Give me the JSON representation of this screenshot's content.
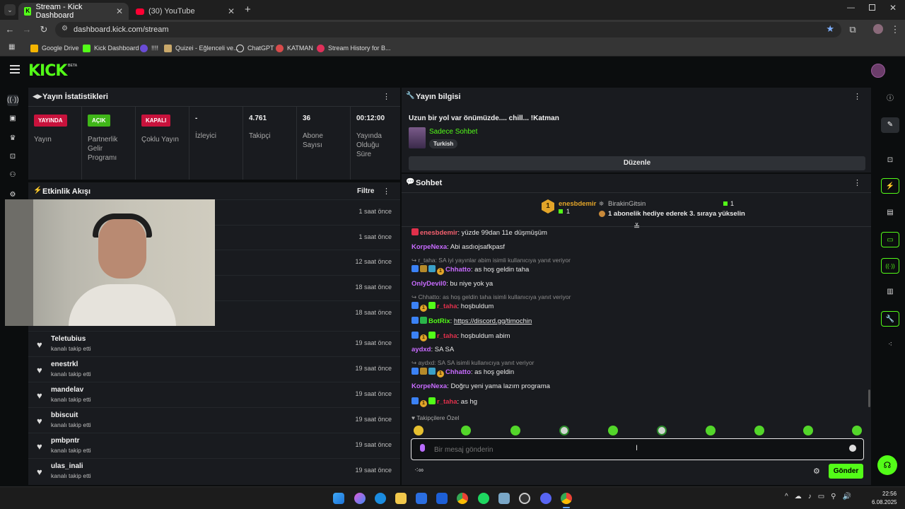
{
  "browser": {
    "tabs": [
      {
        "label": "Stream - Kick Dashboard"
      },
      {
        "label": "(30) YouTube"
      }
    ],
    "url": "dashboard.kick.com/stream",
    "bookmarks": [
      "Google Drive",
      "Kick Dashboard",
      "!!!!",
      "Quizei - Eğlenceli ve...",
      "ChatGPT",
      "KATMAN",
      "Stream History for B..."
    ]
  },
  "app": {
    "logo": "KICK",
    "beta": "BETA"
  },
  "stats": {
    "title": "Yayın İstatistikleri",
    "cells": [
      {
        "badge": "YAYINDA",
        "badge_color": "#c8123c",
        "label": "Yayın"
      },
      {
        "badge": "AÇIK",
        "badge_color": "#3fb618",
        "label": "Partnerlik Gelir Programı"
      },
      {
        "badge": "KAPALI",
        "badge_color": "#c8123c",
        "label": "Çoklu Yayın"
      },
      {
        "value": "-",
        "label": "İzleyici"
      },
      {
        "value": "4.761",
        "label": "Takipçi"
      },
      {
        "value": "36",
        "label": "Abone Sayısı"
      },
      {
        "value": "00:12:00",
        "label": "Yayında Olduğu Süre"
      }
    ]
  },
  "events": {
    "title": "Etkinlik Akışı",
    "filter": "Filtre",
    "hidden_rows": [
      {
        "time": "1 saat önce"
      },
      {
        "time": "1 saat önce"
      },
      {
        "time": "12 saat önce"
      },
      {
        "time": "18 saat önce"
      },
      {
        "time": "18 saat önce"
      }
    ],
    "rows": [
      {
        "name": "Teletubius",
        "sub": "kanalı takip etti",
        "time": "19 saat önce"
      },
      {
        "name": "enestrkl",
        "sub": "kanalı takip etti",
        "time": "19 saat önce"
      },
      {
        "name": "mandelav",
        "sub": "kanalı takip etti",
        "time": "19 saat önce"
      },
      {
        "name": "bbiscuit",
        "sub": "kanalı takip etti",
        "time": "19 saat önce"
      },
      {
        "name": "pmbpntr",
        "sub": "kanalı takip etti",
        "time": "19 saat önce"
      },
      {
        "name": "ulas_inali",
        "sub": "kanalı takip etti",
        "time": "19 saat önce"
      }
    ]
  },
  "stream_info": {
    "title": "Yayın bilgisi",
    "stream_title": "Uzun bir yol var önümüzde.... chill... !Katman",
    "category": "Sadece Sohbet",
    "language": "Turkish",
    "edit_button": "Düzenle"
  },
  "chat": {
    "title": "Sohbet",
    "pinned": {
      "user": "enesbdemir",
      "user_count": "1",
      "gifter": "BirakinGitsin",
      "gifter_count": "1",
      "message": "1 abonelik hediye ederek 3. sıraya yükselin"
    },
    "messages": [
      {
        "user": "enesbdemir",
        "color": "#f5606e",
        "text": ": yüzde 99dan 11e düşmüşüm"
      },
      {
        "user": "KorpeNexa",
        "color": "#c86bff",
        "text": ": Abi asdıojsafkpasf"
      },
      {
        "reply": "↪ r_taha: SA iyi yayınlar abim isimli kullanıcıya yanıt veriyor"
      },
      {
        "user": "Chhatto",
        "color": "#c86bff",
        "text": ": as hoş geldin taha"
      },
      {
        "user": "OnlyDevil0",
        "color": "#c86bff",
        "text": ": bu niye yok ya"
      },
      {
        "reply": "↪ Chhatto: as hoş geldin taha isimli kullanıcıya yanıt veriyor"
      },
      {
        "user": "r_taha",
        "color": "#e0304b",
        "text": ": hoşbuldum"
      },
      {
        "user": "BotRix",
        "color": "#53fc18",
        "text": ": ",
        "link": "https://discord.gg/timochin"
      },
      {
        "user": "r_taha",
        "color": "#e0304b",
        "text": ": hoşbuldum abim"
      },
      {
        "user": "aydxd",
        "color": "#c86bff",
        "text": ": SA SA"
      },
      {
        "reply": "↪ aydxd: SA SA isimli kullanıcıya yanıt veriyor"
      },
      {
        "user": "Chhatto",
        "color": "#c86bff",
        "text": ": as hoş geldin"
      },
      {
        "user": "KorpeNexa",
        "color": "#c86bff",
        "text": ": Doğru yeni yama lazım programa"
      },
      {
        "user": "r_taha",
        "color": "#e0304b",
        "text": ": as hg"
      }
    ],
    "followers_only": "♥ Takipçilere Özel",
    "input_placeholder": "Bir mesaj gönderin",
    "send_button": "Gönder"
  },
  "taskbar": {
    "time": "22:56",
    "date": "6.08.2025"
  },
  "colors": {
    "accent": "#53fc18",
    "panel": "#191b1f",
    "live": "#c8123c"
  }
}
